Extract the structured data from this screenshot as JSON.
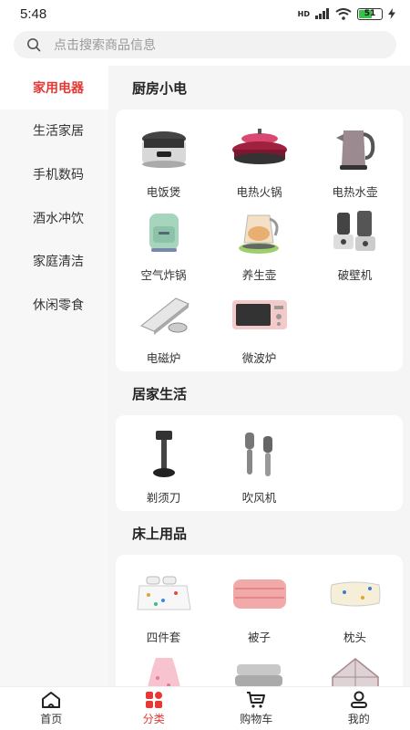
{
  "status": {
    "time": "5:48",
    "battery": "51",
    "network": "HD"
  },
  "search": {
    "placeholder": "点击搜索商品信息"
  },
  "sidebar": {
    "items": [
      {
        "label": "家用电器"
      },
      {
        "label": "生活家居"
      },
      {
        "label": "手机数码"
      },
      {
        "label": "酒水冲饮"
      },
      {
        "label": "家庭清洁"
      },
      {
        "label": "休闲零食"
      }
    ]
  },
  "sections": [
    {
      "title": "厨房小电",
      "items": [
        {
          "label": "电饭煲",
          "icon": "rice-cooker-icon"
        },
        {
          "label": "电热火锅",
          "icon": "hot-pot-icon"
        },
        {
          "label": "电热水壶",
          "icon": "kettle-icon"
        },
        {
          "label": "空气炸锅",
          "icon": "air-fryer-icon"
        },
        {
          "label": "养生壶",
          "icon": "health-pot-icon"
        },
        {
          "label": "破壁机",
          "icon": "blender-icon"
        },
        {
          "label": "电磁炉",
          "icon": "induction-cooker-icon"
        },
        {
          "label": "微波炉",
          "icon": "microwave-icon"
        }
      ]
    },
    {
      "title": "居家生活",
      "items": [
        {
          "label": "剃须刀",
          "icon": "razor-icon"
        },
        {
          "label": "吹风机",
          "icon": "hair-dryer-icon"
        }
      ]
    },
    {
      "title": "床上用品",
      "items": [
        {
          "label": "四件套",
          "icon": "bedding-set-icon"
        },
        {
          "label": "被子",
          "icon": "quilt-icon"
        },
        {
          "label": "枕头",
          "icon": "pillow-icon"
        },
        {
          "label": "",
          "icon": "nightgown-icon"
        },
        {
          "label": "",
          "icon": "mattress-icon"
        },
        {
          "label": "",
          "icon": "mosquito-net-icon"
        }
      ]
    }
  ],
  "tabbar": {
    "tabs": [
      {
        "label": "首页"
      },
      {
        "label": "分类"
      },
      {
        "label": "购物车"
      },
      {
        "label": "我的"
      }
    ]
  },
  "colors": {
    "accent": "#e53935",
    "background": "#f5f5f5"
  }
}
